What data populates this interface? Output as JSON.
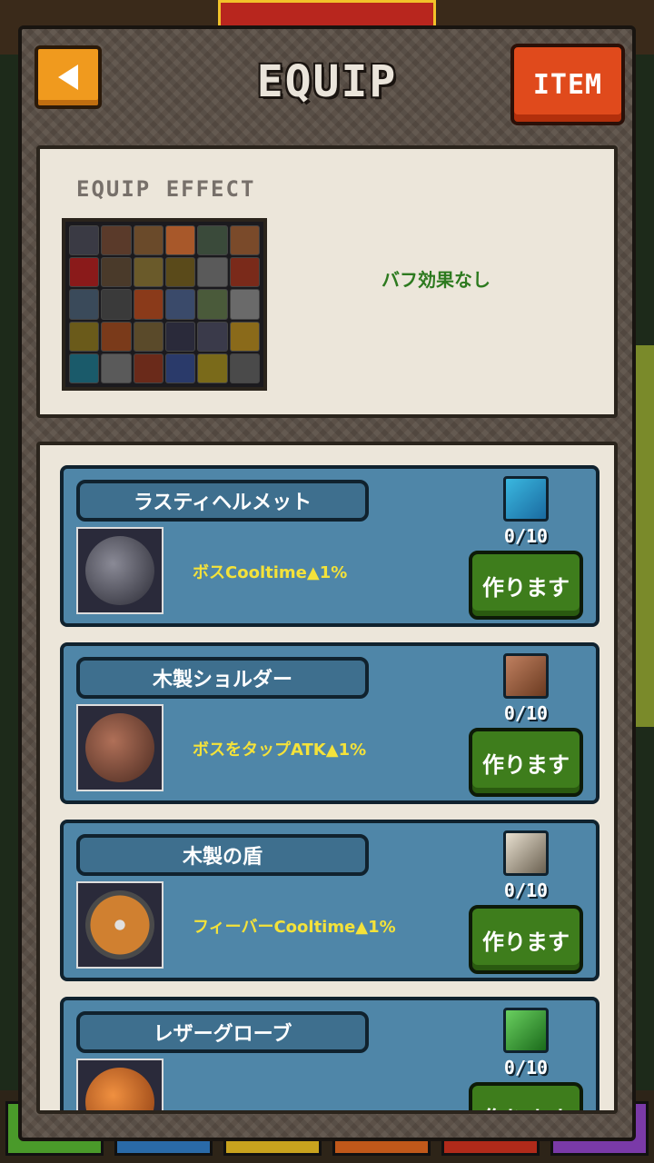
{
  "header": {
    "title": "EQUIP",
    "item_label": "ITEM"
  },
  "effect_panel": {
    "label": "EQUIP EFFECT",
    "buff_text": "バフ効果なし"
  },
  "cards": [
    {
      "name": "ラスティヘルメット",
      "effect": "ボスCooltime▲1%",
      "count": "0/10",
      "button": "作ります"
    },
    {
      "name": "木製ショルダー",
      "effect": "ボスをタップATK▲1%",
      "count": "0/10",
      "button": "作ります"
    },
    {
      "name": "木製の盾",
      "effect": "フィーバーCooltime▲1%",
      "count": "0/10",
      "button": "作ります"
    },
    {
      "name": "レザーグローブ",
      "effect": "",
      "count": "0/10",
      "button": "作ります"
    }
  ],
  "colors": {
    "accent_orange": "#f09a1e",
    "item_red": "#e04a1c",
    "card_blue": "#4f86a8",
    "make_green": "#3e7d1c",
    "buff_green": "#2d7a1f",
    "effect_yellow": "#f4e23a"
  }
}
